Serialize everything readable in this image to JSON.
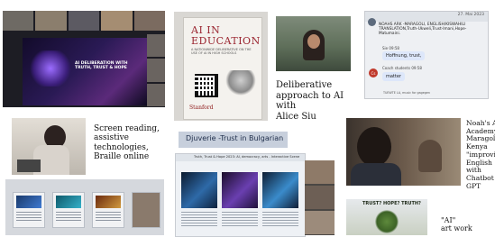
{
  "captions": {
    "deliberative": "Deliberative\napproach to AI with\nAlice Siu",
    "screen_reading": "Screen reading,\nassistive\ntechnologies,\nBraille online",
    "noahs_ark": "Noah's A\nAcademy\nMaragoli\nKenya\n\"improvi\nEnglish\nwith\nChatbot\nGPT",
    "ai_art": "\"AI\"\nart work"
  },
  "slide_deliberation": {
    "title": "AI DELIBERATION WITH\nTRUTH, TRUST & HOPE"
  },
  "book": {
    "title": "AI IN\nEDUCATION",
    "subtitle": "A NATIONWIDE DELIBERATIVE ON THE USE OF AI IN HIGH SCHOOLS",
    "publisher": "Stanford"
  },
  "chat": {
    "date": "27. Mai 2023",
    "first_message": "NOAHS ARK -MARAGOLI, ENGLISH/KISWAHILI TRANSLATION,Truth-Ukweli,Trust-Imani,Hope-Matumaini.",
    "sender_1": "Sie",
    "time_1": "09:58",
    "reply_1": "Hoffnung, trust,",
    "sender_2": "Coach students",
    "time_2": "09:58",
    "reply_2": "matter",
    "avatar_initials": "Cs",
    "footer": "TUEWTE LA, music for gagegen"
  },
  "djuverie_slide": {
    "text": "Djuverie -Trust in Bulgarian"
  },
  "web_page": {
    "header": "Truth, Trust & Hope 2023: AI, democracy, arts - Interactive Scene"
  },
  "art_poster": {
    "text": "TRUST? HOPE? TRUTH?"
  }
}
